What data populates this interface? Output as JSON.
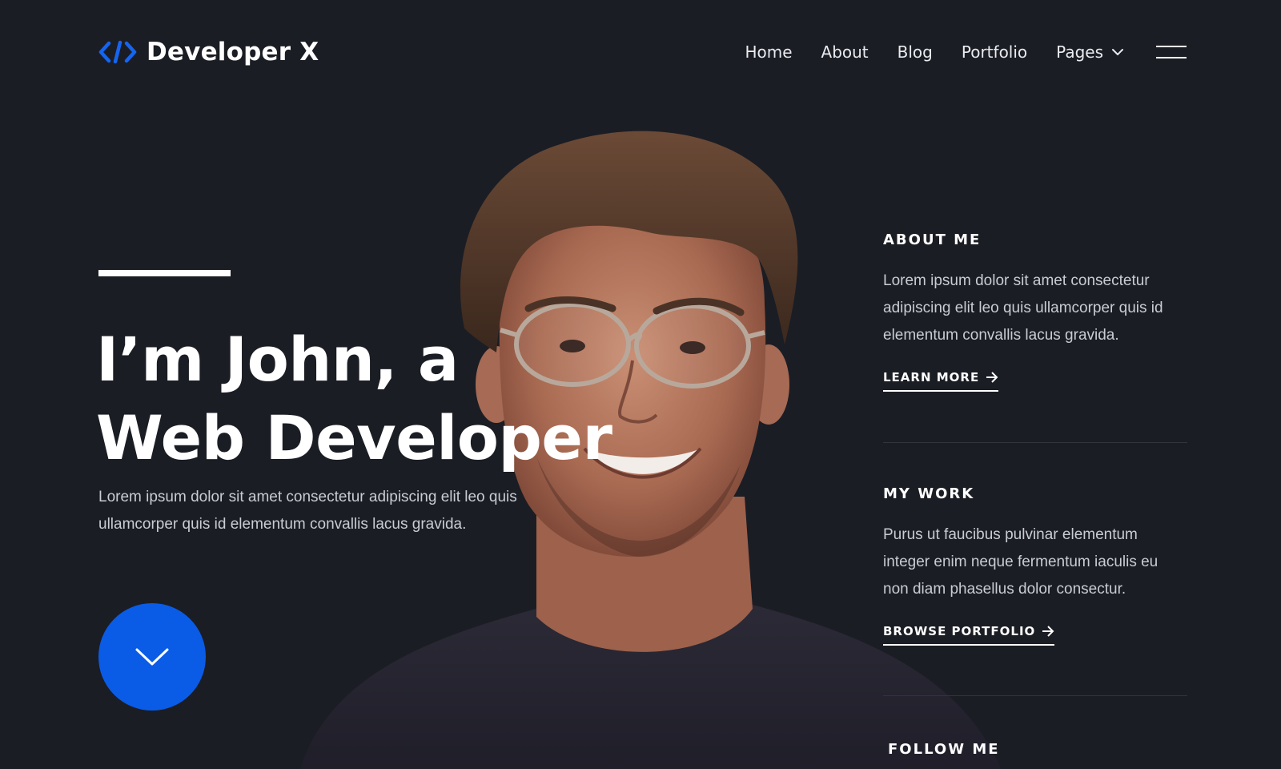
{
  "colors": {
    "background": "#1b1d24",
    "accent": "#0a5ce6",
    "text_primary": "#ffffff",
    "text_muted": "#c9ccd3"
  },
  "header": {
    "brand_icon": "code-brackets-icon",
    "brand_name": "Developer X",
    "nav": [
      {
        "label": "Home"
      },
      {
        "label": "About"
      },
      {
        "label": "Blog"
      },
      {
        "label": "Portfolio"
      },
      {
        "label": "Pages",
        "icon": "chevron-down-icon"
      }
    ],
    "menu_icon": "hamburger-menu-icon"
  },
  "hero": {
    "title_line1": "I’m John, a",
    "title_line2": "Web Developer",
    "description": "Lorem ipsum dolor sit amet consectetur adipiscing elit leo quis ullamcorper quis id elementum convallis lacus gravida.",
    "scroll_icon": "chevron-down-icon"
  },
  "about": {
    "heading": "ABOUT ME",
    "text": "Lorem ipsum dolor sit amet consectetur adipiscing elit leo quis ullamcorper quis id elementum convallis lacus gravida.",
    "link": "LEARN MORE",
    "link_icon": "arrow-right-icon"
  },
  "work": {
    "heading": "MY WORK",
    "text": "Purus ut faucibus pulvinar elementum integer enim neque fermentum iaculis eu non diam phasellus dolor consectur.",
    "link": "BROWSE PORTFOLIO",
    "link_icon": "arrow-right-icon"
  },
  "follow": {
    "heading": "FOLLOW ME"
  }
}
